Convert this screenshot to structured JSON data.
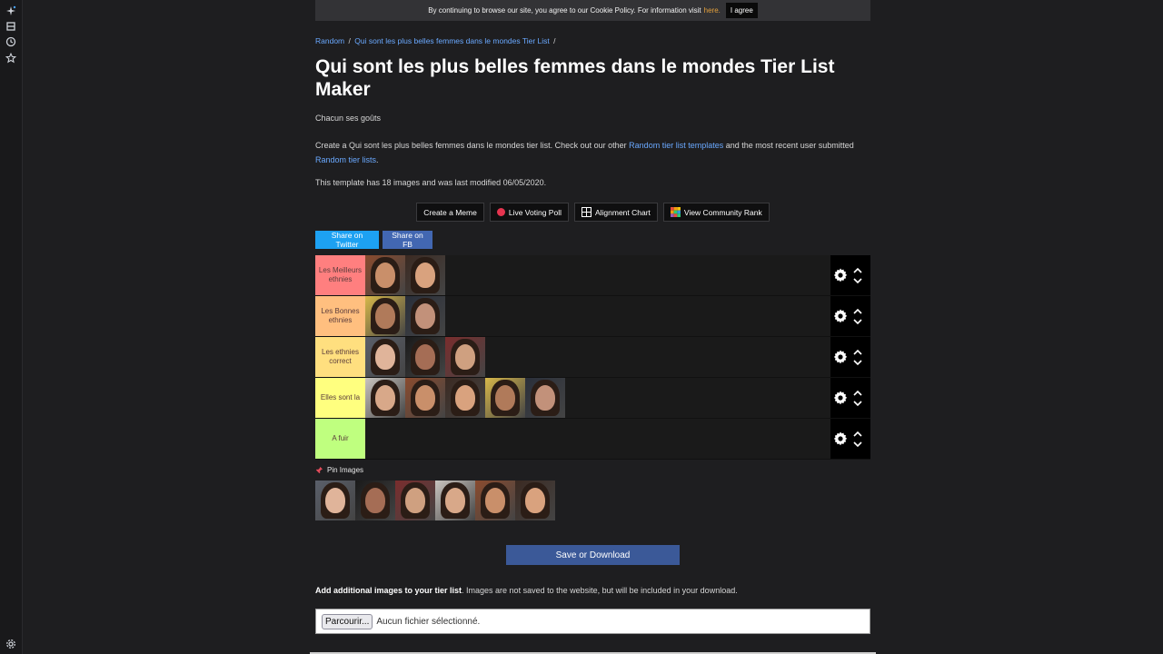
{
  "leftbar": {
    "icons": [
      "sparkle-icon",
      "bookmark-icon",
      "clock-icon",
      "star-icon",
      "settings-icon"
    ]
  },
  "cookie": {
    "text": "By continuing to browse our site, you agree to our Cookie Policy. For information visit",
    "link": "here.",
    "agree": "I agree"
  },
  "breadcrumb": {
    "items": [
      "Random",
      "Qui sont les plus belles femmes dans le mondes Tier List"
    ],
    "sep": "/"
  },
  "title": "Qui sont les plus belles femmes dans le mondes Tier List Maker",
  "subtitle": "Chacun ses goûts",
  "intro": {
    "text1": "Create a Qui sont les plus belles femmes dans le mondes tier list. Check out our other ",
    "link1": "Random tier list templates",
    "text2": " and the most recent user submitted ",
    "link2": "Random tier lists",
    "text3": "."
  },
  "meta": "This template has 18 images and was last modified 06/05/2020.",
  "actions": {
    "meme": "Create a Meme",
    "poll": "Live Voting Poll",
    "alignment": "Alignment Chart",
    "community": "View Community Rank"
  },
  "share": {
    "twitter": "Share on Twitter",
    "fb": "Share on FB"
  },
  "tiers": [
    {
      "label": "Les Meilleurs ethnies",
      "color": "#ff7f7f",
      "count": 2
    },
    {
      "label": "Les Bonnes ethnies",
      "color": "#ffbf7f",
      "count": 2
    },
    {
      "label": "Les ethnies correct",
      "color": "#ffdf7f",
      "count": 3
    },
    {
      "label": "Elles sont la",
      "color": "#ffff7f",
      "count": 5
    },
    {
      "label": "A fuir",
      "color": "#bfff7f",
      "count": 0
    }
  ],
  "pin": {
    "label": "Pin Images",
    "count": 6
  },
  "save": "Save or Download",
  "additional": {
    "bold": "Add additional images to your tier list",
    "rest": ". Images are not saved to the website, but will be included in your download."
  },
  "file": {
    "button": "Parcourir...",
    "status": "Aucun fichier sélectionné."
  }
}
